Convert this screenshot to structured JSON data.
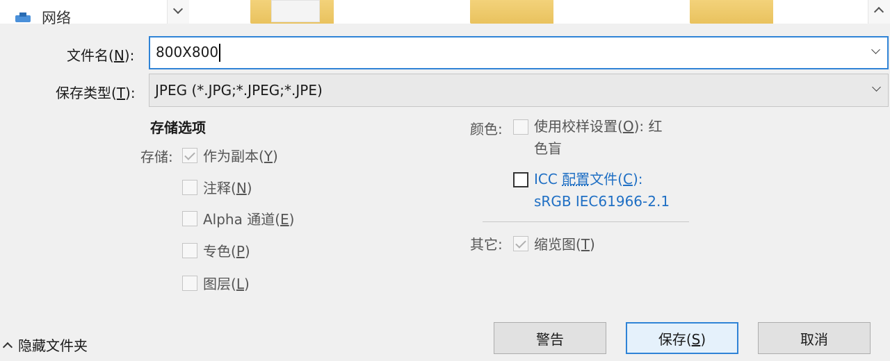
{
  "nav": {
    "network_label": "网络"
  },
  "form": {
    "filename_label": "文件名(",
    "filename_key": "N",
    "filename_label_end": "):",
    "filename_value": "800X800",
    "filetype_label": "保存类型(",
    "filetype_key": "T",
    "filetype_label_end": "):",
    "filetype_value": "JPEG (*.JPG;*.JPEG;*.JPE)"
  },
  "options": {
    "section_title": "存储选项",
    "store_label": "存储:",
    "items": [
      {
        "label": "作为副本(",
        "key": "Y",
        "end": ")",
        "checked": true
      },
      {
        "label": "注释(",
        "key": "N",
        "end": ")",
        "checked": false
      },
      {
        "label": "Alpha 通道(",
        "key": "E",
        "end": ")",
        "checked": false
      },
      {
        "label": "专色(",
        "key": "P",
        "end": ")",
        "checked": false
      },
      {
        "label": "图层(",
        "key": "L",
        "end": ")",
        "checked": false
      }
    ],
    "color_label": "颜色:",
    "proof_label_line1": "使用校样设置(",
    "proof_key": "O",
    "proof_label_line1_end": "): 红",
    "proof_label_line2": "色盲",
    "proof_checked": false,
    "icc_prefix": "ICC ",
    "icc_link": "配置",
    "icc_suffix": "文件(",
    "icc_key": "C",
    "icc_end": "):",
    "icc_profile": "sRGB IEC61966-2.1",
    "icc_checked": false,
    "other_label": "其它:",
    "thumbnail_label": "缩览图(",
    "thumbnail_key": "T",
    "thumbnail_end": ")",
    "thumbnail_checked": true
  },
  "footer": {
    "hide_folders_label": "隐藏文件夹",
    "warning_button": "警告",
    "save_button": "保存(",
    "save_key": "S",
    "save_end": ")",
    "cancel_button": "取消"
  },
  "colors": {
    "accent": "#2f83d6",
    "link": "#1f6fc4",
    "folder": "#f3d27a",
    "background": "#f0f0f0"
  }
}
